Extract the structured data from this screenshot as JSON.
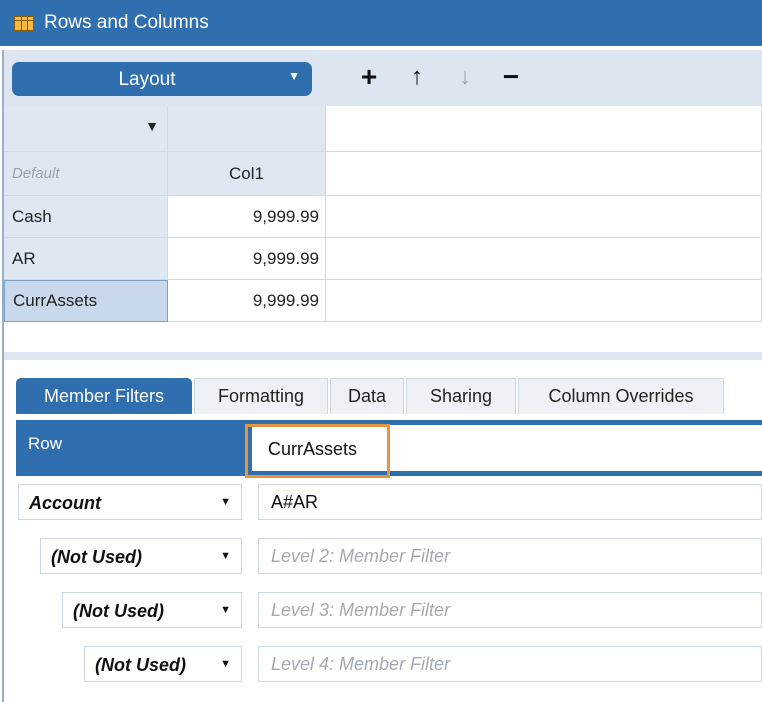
{
  "window": {
    "title": "Rows and Columns"
  },
  "toolbar": {
    "layout_label": "Layout",
    "add_icon": "plus-icon",
    "move_up_icon": "arrow-up-icon",
    "move_down_icon": "arrow-down-icon",
    "remove_icon": "minus-icon"
  },
  "grid": {
    "filter_icon": "filter-icon",
    "corner_label": "Default",
    "column_header": "Col1",
    "rows": [
      {
        "label": "Cash",
        "value": "9,999.99"
      },
      {
        "label": "AR",
        "value": "9,999.99"
      },
      {
        "label": "CurrAssets",
        "value": "9,999.99"
      }
    ],
    "selected_row": "CurrAssets"
  },
  "tabs": [
    {
      "label": "Member Filters",
      "active": true
    },
    {
      "label": "Formatting",
      "active": false
    },
    {
      "label": "Data",
      "active": false
    },
    {
      "label": "Sharing",
      "active": false
    },
    {
      "label": "Column Overrides",
      "active": false
    }
  ],
  "row_editor": {
    "label": "Row",
    "name_value": "CurrAssets"
  },
  "member_filters": [
    {
      "dimension": "Account",
      "value": "A#AR",
      "placeholder": ""
    },
    {
      "dimension": "(Not Used)",
      "value": "",
      "placeholder": "Level 2: Member Filter"
    },
    {
      "dimension": "(Not Used)",
      "value": "",
      "placeholder": "Level 3: Member Filter"
    },
    {
      "dimension": "(Not Used)",
      "value": "",
      "placeholder": "Level 4: Member Filter"
    }
  ],
  "colors": {
    "accent": "#2f6fb0",
    "highlight": "#e3963e",
    "header_bg": "#dfe8f2"
  }
}
